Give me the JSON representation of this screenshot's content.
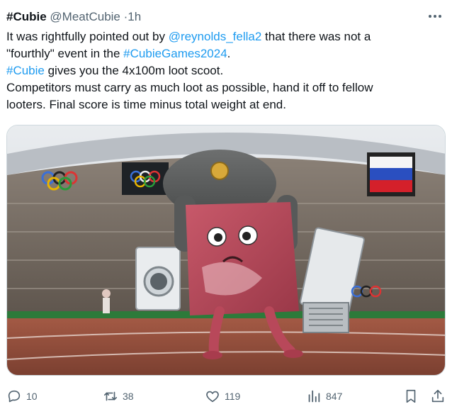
{
  "post": {
    "display_name": "#Cubie",
    "handle": "@MeatCubie",
    "separator": "·",
    "time": "1h",
    "text": {
      "line1_a": "It was rightfully pointed out by ",
      "line1_mention": "@reynolds_fella2",
      "line1_b": " that there was not a",
      "line2_a": "\"fourthly\" event in the ",
      "line2_hashtag": "#CubieGames2024",
      "line2_b": ".",
      "line3_hashtag": "#Cubie",
      "line3_b": " gives you the 4x100m loot scoot.",
      "line4": "Competitors must carry as much loot as possible, hand it off to fellow",
      "line5": "looters. Final score is time minus total weight at end."
    }
  },
  "metrics": {
    "replies": "10",
    "reposts": "38",
    "likes": "119",
    "views": "847"
  },
  "icons": {
    "more": "more-icon",
    "reply": "reply-icon",
    "repost": "repost-icon",
    "like": "heart-icon",
    "views": "views-icon",
    "bookmark": "bookmark-icon",
    "share": "share-icon"
  },
  "colors": {
    "text": "#0f1419",
    "secondary": "#536471",
    "link": "#1d9bf0",
    "border": "#cfd9de"
  }
}
